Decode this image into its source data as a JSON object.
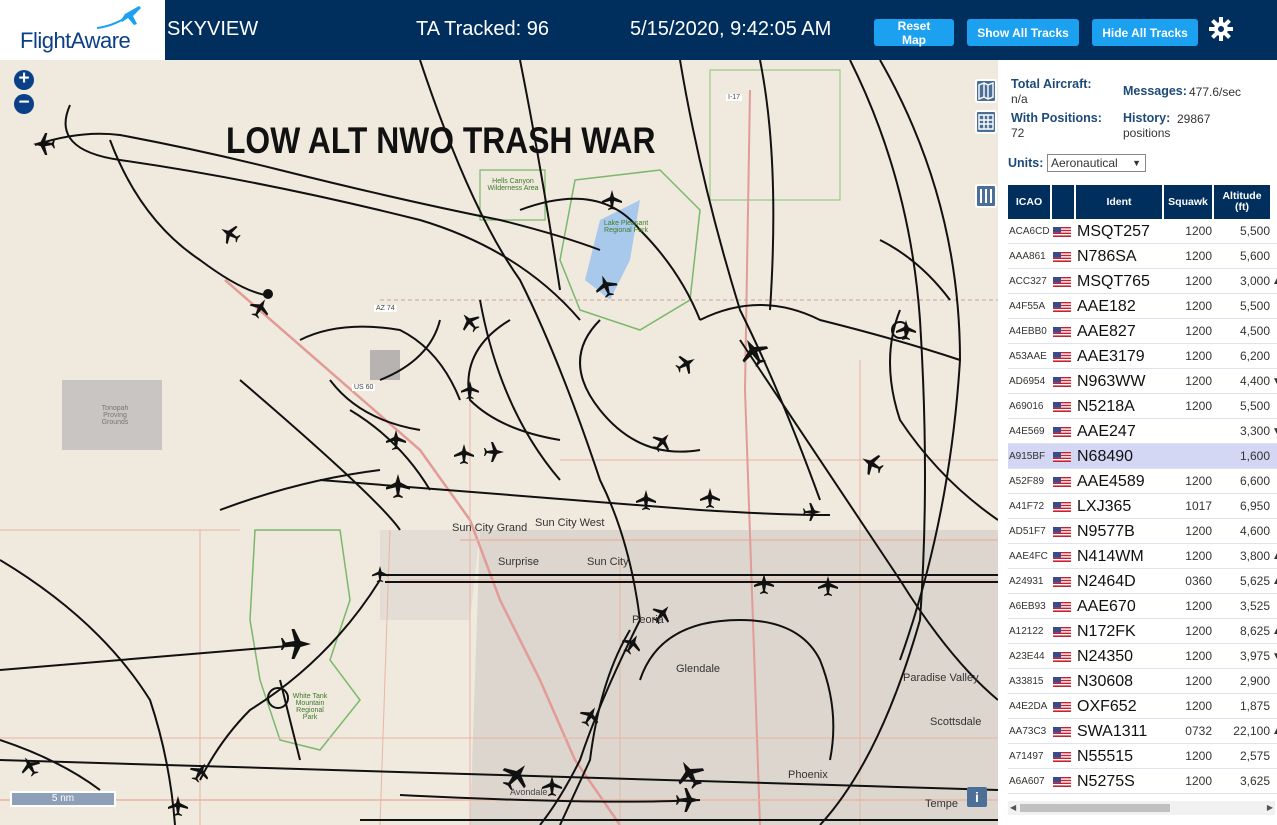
{
  "header": {
    "logo_text": "FlightAware",
    "app_name": "SKYVIEW",
    "tracked": "TA Tracked: 96",
    "clock": "5/15/2020, 9:42:05 AM",
    "buttons": {
      "reset": "Reset Map",
      "show": "Show All Tracks",
      "hide": "Hide All Tracks"
    }
  },
  "map": {
    "overlay_text": "LOW ALT NWO TRASH WAR",
    "scale": "5 nm",
    "info": "i",
    "places": {
      "sun_city_grand": "Sun City Grand",
      "sun_city_west": "Sun City West",
      "surprise": "Surprise",
      "sun_city": "Sun City",
      "peoria": "Peoria",
      "glendale": "Glendale",
      "paradise_valley": "Paradise Valley",
      "scottsdale": "Scottsdale",
      "phoenix": "Phoenix",
      "tempe": "Tempe",
      "avondale": "Avondale",
      "lake_pleasant": "Lake Pleasant Regional Park",
      "hells_canyon": "Hells Canyon Wilderness Area",
      "estrella": "White Tank Mountain Regional Park",
      "proving": "Tonopah Proving Grounds",
      "az74": "AZ 74",
      "us60": "US 60",
      "i17": "I-17"
    }
  },
  "sidebar": {
    "total_label": "Total Aircraft:",
    "total_val": "n/a",
    "messages_label": "Messages:",
    "messages_val": "477.6/sec",
    "withpos_label": "With Positions:",
    "withpos_val": "72",
    "history_label": "History:",
    "history_val": "29867",
    "history_unit": "positions",
    "units_label": "Units:",
    "units_val": "Aeronautical"
  },
  "table": {
    "headers": {
      "icao": "ICAO",
      "ident": "Ident",
      "squawk": "Squawk",
      "altitude": "Altitude (ft)"
    },
    "rows": [
      {
        "icao": "ACA6CD",
        "ident": "MSQT257",
        "squawk": "1200",
        "alt": "5,500",
        "arrow": ""
      },
      {
        "icao": "AAA861",
        "ident": "N786SA",
        "squawk": "1200",
        "alt": "5,600",
        "arrow": ""
      },
      {
        "icao": "ACC327",
        "ident": "MSQT765",
        "squawk": "1200",
        "alt": "3,000",
        "arrow": "▲"
      },
      {
        "icao": "A4F55A",
        "ident": "AAE182",
        "squawk": "1200",
        "alt": "5,500",
        "arrow": ""
      },
      {
        "icao": "A4EBB0",
        "ident": "AAE827",
        "squawk": "1200",
        "alt": "4,500",
        "arrow": ""
      },
      {
        "icao": "A53AAE",
        "ident": "AAE3179",
        "squawk": "1200",
        "alt": "6,200",
        "arrow": ""
      },
      {
        "icao": "AD6954",
        "ident": "N963WW",
        "squawk": "1200",
        "alt": "4,400",
        "arrow": "▼"
      },
      {
        "icao": "A69016",
        "ident": "N5218A",
        "squawk": "1200",
        "alt": "5,500",
        "arrow": ""
      },
      {
        "icao": "A4E569",
        "ident": "AAE247",
        "squawk": "",
        "alt": "3,300",
        "arrow": "▼"
      },
      {
        "icao": "A915BF",
        "ident": "N68490",
        "squawk": "",
        "alt": "1,600",
        "arrow": ""
      },
      {
        "icao": "A52F89",
        "ident": "AAE4589",
        "squawk": "1200",
        "alt": "6,600",
        "arrow": ""
      },
      {
        "icao": "A41F72",
        "ident": "LXJ365",
        "squawk": "1017",
        "alt": "6,950",
        "arrow": ""
      },
      {
        "icao": "AD51F7",
        "ident": "N9577B",
        "squawk": "1200",
        "alt": "4,600",
        "arrow": ""
      },
      {
        "icao": "AAE4FC",
        "ident": "N414WM",
        "squawk": "1200",
        "alt": "3,800",
        "arrow": "▲"
      },
      {
        "icao": "A24931",
        "ident": "N2464D",
        "squawk": "0360",
        "alt": "5,625",
        "arrow": "▲"
      },
      {
        "icao": "A6EB93",
        "ident": "AAE670",
        "squawk": "1200",
        "alt": "3,525",
        "arrow": ""
      },
      {
        "icao": "A12122",
        "ident": "N172FK",
        "squawk": "1200",
        "alt": "8,625",
        "arrow": "▲"
      },
      {
        "icao": "A23E44",
        "ident": "N24350",
        "squawk": "1200",
        "alt": "3,975",
        "arrow": "▼"
      },
      {
        "icao": "A33815",
        "ident": "N30608",
        "squawk": "1200",
        "alt": "2,900",
        "arrow": ""
      },
      {
        "icao": "A4E2DA",
        "ident": "OXF652",
        "squawk": "1200",
        "alt": "1,875",
        "arrow": ""
      },
      {
        "icao": "AA73C3",
        "ident": "SWA1311",
        "squawk": "0732",
        "alt": "22,100",
        "arrow": "▲"
      },
      {
        "icao": "A71497",
        "ident": "N55515",
        "squawk": "1200",
        "alt": "2,575",
        "arrow": ""
      },
      {
        "icao": "A6A607",
        "ident": "N5275S",
        "squawk": "1200",
        "alt": "3,625",
        "arrow": ""
      }
    ]
  },
  "colors": {
    "header_bg": "#002f5d",
    "button": "#1ba1f0",
    "selected_row": "#d3d7f3"
  }
}
